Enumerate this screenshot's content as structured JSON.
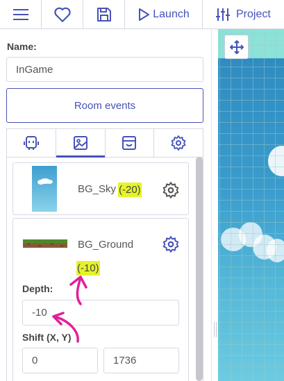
{
  "toolbar": {
    "menu_icon": "hamburger-menu-icon",
    "favorite_icon": "heart-icon",
    "save_icon": "save-icon",
    "launch_label": "Launch",
    "project_label": "Project"
  },
  "room": {
    "name_label": "Name:",
    "name_value": "InGame",
    "room_events_label": "Room events"
  },
  "tabs": [
    {
      "name": "copies",
      "icon": "robot-icon",
      "active": false
    },
    {
      "name": "backgrounds",
      "icon": "image-icon",
      "active": true
    },
    {
      "name": "tiles",
      "icon": "window-icon",
      "active": false
    },
    {
      "name": "properties",
      "icon": "gear-icon",
      "active": false
    }
  ],
  "backgrounds": [
    {
      "name": "BG_Sky",
      "depth_badge": "(-20)"
    },
    {
      "name": "BG_Ground",
      "depth_badge": "(-10)"
    }
  ],
  "editor": {
    "depth_label": "Depth:",
    "depth_value": "-10",
    "shift_label": "Shift (X, Y)",
    "shift_x": "0",
    "shift_y": "1736"
  },
  "colors": {
    "accent": "#4652b8",
    "highlight": "#e6f32a",
    "annotation": "#e0209a"
  }
}
